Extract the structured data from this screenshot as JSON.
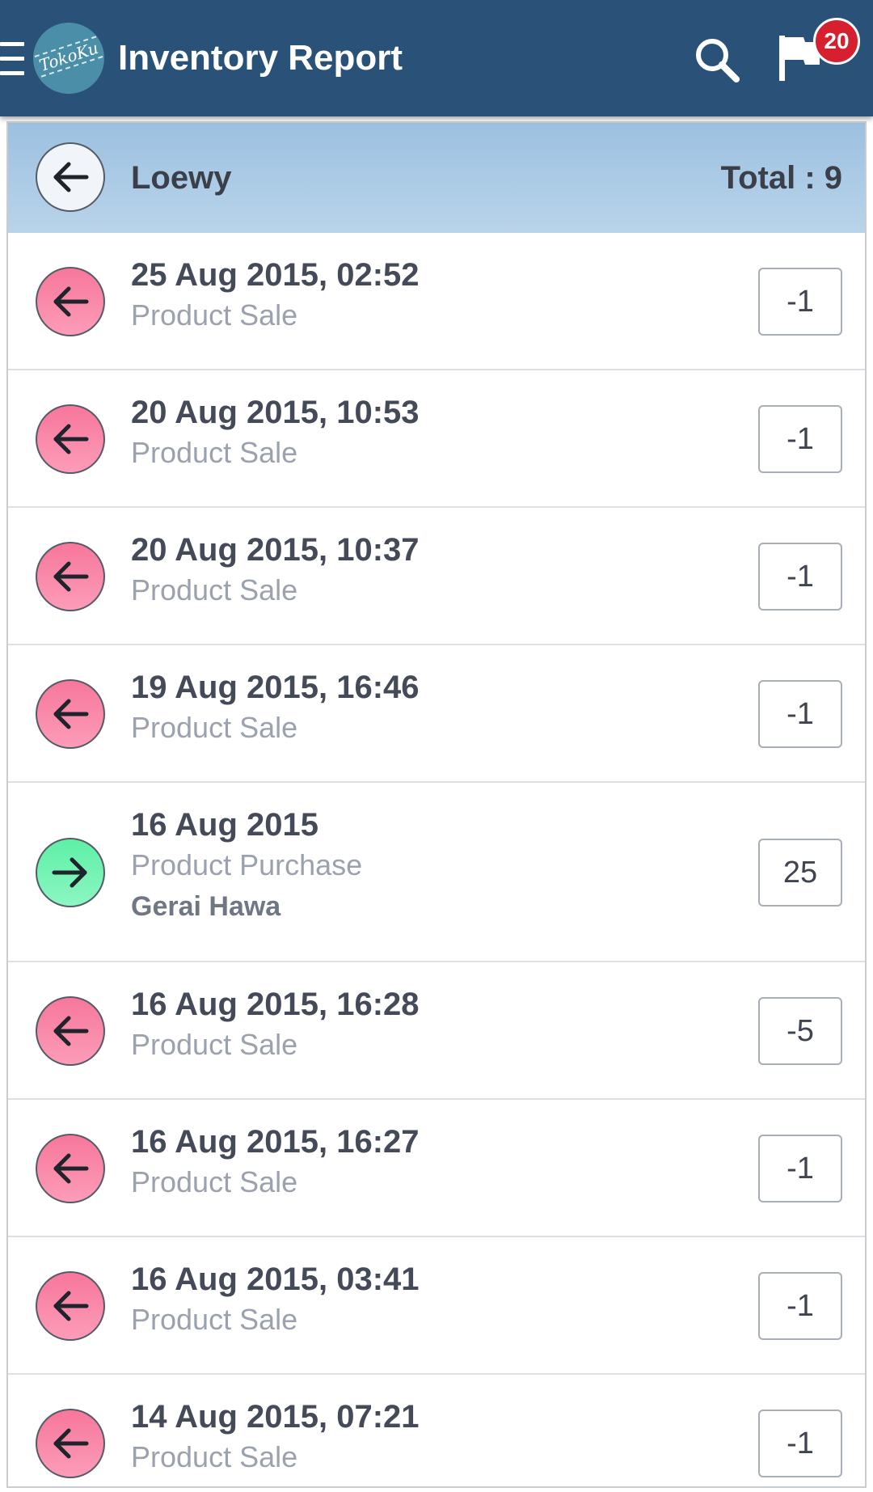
{
  "app": {
    "title": "Inventory Report",
    "logo_text": "TokoKu",
    "notification_count": "20"
  },
  "colors": {
    "appbar": "#2a5278",
    "badge": "#d6202f",
    "header_band": "#b9d4ea",
    "sale_icon": "#f7779b",
    "purchase_icon": "#5ef0a6"
  },
  "header": {
    "product_name": "Loewy",
    "total_label": "Total : 9",
    "back_icon": "arrow-left-icon"
  },
  "transactions": [
    {
      "date": "25 Aug 2015, 02:52",
      "type": "Product Sale",
      "qty": "-1",
      "direction": "out",
      "icon": "arrow-left-icon"
    },
    {
      "date": "20 Aug 2015, 10:53",
      "type": "Product Sale",
      "qty": "-1",
      "direction": "out",
      "icon": "arrow-left-icon"
    },
    {
      "date": "20 Aug 2015, 10:37",
      "type": "Product Sale",
      "qty": "-1",
      "direction": "out",
      "icon": "arrow-left-icon"
    },
    {
      "date": "19 Aug 2015, 16:46",
      "type": "Product Sale",
      "qty": "-1",
      "direction": "out",
      "icon": "arrow-left-icon"
    },
    {
      "date": "16 Aug 2015",
      "type": "Product Purchase",
      "supplier": "Gerai Hawa",
      "qty": "25",
      "direction": "in",
      "icon": "arrow-right-icon"
    },
    {
      "date": "16 Aug 2015, 16:28",
      "type": "Product Sale",
      "qty": "-5",
      "direction": "out",
      "icon": "arrow-left-icon"
    },
    {
      "date": "16 Aug 2015, 16:27",
      "type": "Product Sale",
      "qty": "-1",
      "direction": "out",
      "icon": "arrow-left-icon"
    },
    {
      "date": "16 Aug 2015, 03:41",
      "type": "Product Sale",
      "qty": "-1",
      "direction": "out",
      "icon": "arrow-left-icon"
    },
    {
      "date": "14 Aug 2015, 07:21",
      "type": "Product Sale",
      "qty": "-1",
      "direction": "out",
      "icon": "arrow-left-icon"
    }
  ]
}
